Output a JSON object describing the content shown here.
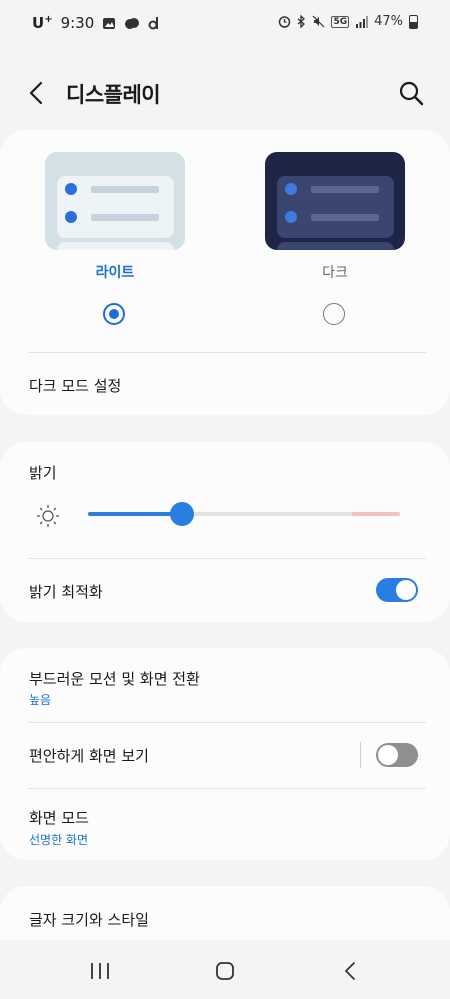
{
  "status_bar": {
    "carrier": "U",
    "carrier_sup": "+",
    "time": "9:30",
    "network": "5G",
    "battery": "47%",
    "battery_level": 0.47,
    "icons": [
      "gallery-icon",
      "weather-icon",
      "d-app-icon",
      "alarm-icon",
      "bluetooth-icon",
      "mute-icon",
      "signal-icon",
      "battery-icon"
    ]
  },
  "header": {
    "title": "디스플레이",
    "back_icon": "chevron-left-icon",
    "search_icon": "search-icon"
  },
  "theme": {
    "light_label": "라이트",
    "dark_label": "다크",
    "selected": "light",
    "dark_mode_settings": "다크 모드 설정"
  },
  "brightness": {
    "title": "밝기",
    "level": 0.3,
    "adaptive_label": "밝기 최적화",
    "adaptive_on": true
  },
  "motion": {
    "label": "부드러운 모션 및 화면 전환",
    "value": "높음"
  },
  "eye_comfort": {
    "label": "편안하게 화면 보기",
    "on": false
  },
  "screen_mode": {
    "label": "화면 모드",
    "value": "선명한 화면"
  },
  "font": {
    "label": "글자 크기와 스타일"
  },
  "colors": {
    "accent": "#2a7de1",
    "link": "#1c6fd1",
    "background": "#f4f4f4",
    "card": "#fcfcfc"
  }
}
